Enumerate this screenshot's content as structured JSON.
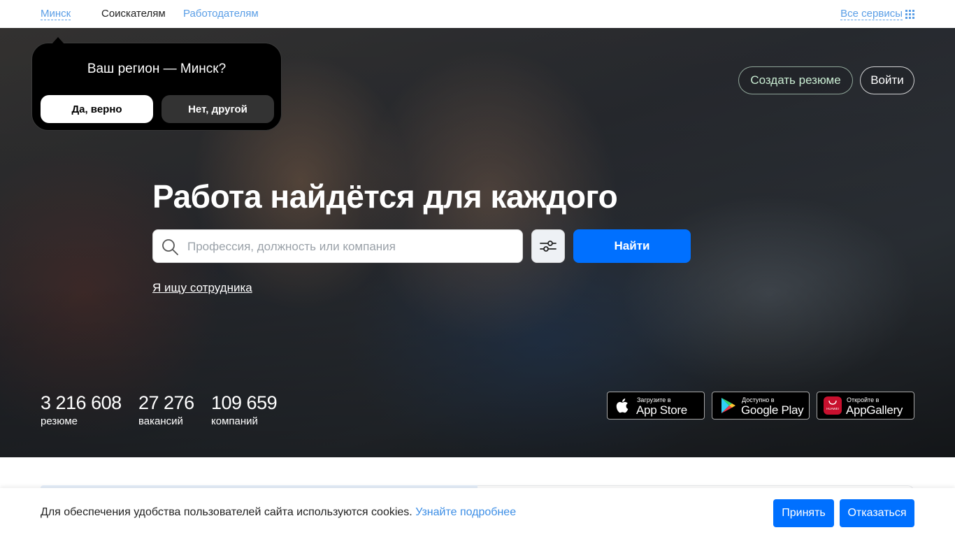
{
  "nav": {
    "region": "Минск",
    "seekers": "Соискателям",
    "employers": "Работодателям",
    "all_services": "Все сервисы",
    "services_icon": "grid-icon"
  },
  "region_popup": {
    "title": "Ваш регион — Минск?",
    "yes_label": "Да, верно",
    "no_label": "Нет, другой"
  },
  "header_actions": {
    "create_resume": "Создать резюме",
    "login": "Войти"
  },
  "hero": {
    "headline": "Работа найдётся для каждого",
    "search": {
      "placeholder": "Профессия, должность или компания",
      "value": "",
      "icon": "search-icon",
      "filter_icon": "sliders-icon"
    },
    "find_label": "Найти",
    "employer_link": "Я ищу сотрудника"
  },
  "stats": [
    {
      "value": "3 216 608",
      "label": "резюме"
    },
    {
      "value": "27 276",
      "label": "вакансий"
    },
    {
      "value": "109 659",
      "label": "компаний"
    }
  ],
  "store_badges": [
    {
      "small": "Загрузите в",
      "big": "App Store",
      "icon": "apple-icon"
    },
    {
      "small": "Доступно в",
      "big": "Google Play",
      "icon": "google-play-icon"
    },
    {
      "small": "Откройте в",
      "big": "AppGallery",
      "icon": "huawei-icon",
      "icon_text": "HUAWEI"
    }
  ],
  "cookie": {
    "text": "Для обеспечения удобства пользователей сайта используются cookies.",
    "link": "Узнайте подробнее",
    "accept": "Принять",
    "decline": "Отказаться"
  },
  "colors": {
    "accent": "#0070ff",
    "link": "#5a9ee6",
    "popup_bg": "#000000",
    "create_resume_text": "#c9ecd2"
  }
}
